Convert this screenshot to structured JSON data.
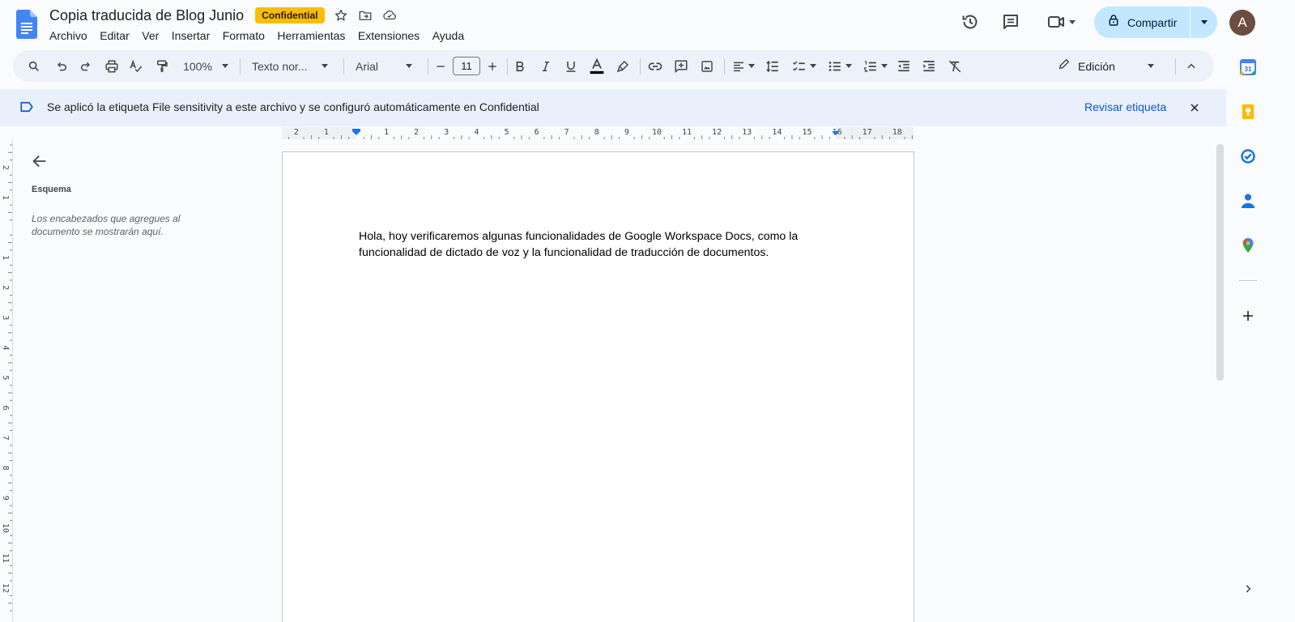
{
  "header": {
    "title": "Copia traducida de Blog Junio",
    "badge": "Confidential",
    "menu": [
      "Archivo",
      "Editar",
      "Ver",
      "Insertar",
      "Formato",
      "Herramientas",
      "Extensiones",
      "Ayuda"
    ],
    "share_label": "Compartir",
    "avatar_initial": "A"
  },
  "toolbar": {
    "zoom": "100%",
    "style": "Texto nor...",
    "font": "Arial",
    "font_size": "11",
    "mode": "Edición"
  },
  "notice": {
    "text": "Se aplicó la etiqueta File sensitivity a este archivo y se configuró automáticamente en Confidential",
    "link": "Revisar etiqueta"
  },
  "outline": {
    "title": "Esquema",
    "hint": "Los encabezados que agregues al documento se mostrarán aquí."
  },
  "document": {
    "body": "Hola, hoy verificaremos algunas funcionalidades de Google Workspace Docs, como la funcionalidad de dictado de voz y la funcionalidad de traducción de documentos."
  },
  "rulers": {
    "horizontal_labels": [
      "2",
      "1",
      "",
      "1",
      "2",
      "3",
      "4",
      "5",
      "6",
      "7",
      "8",
      "9",
      "10",
      "11",
      "12",
      "13",
      "14",
      "15",
      "16",
      "17",
      "18"
    ],
    "vertical_labels": [
      "2",
      "1",
      "",
      "1",
      "2",
      "3",
      "4",
      "5",
      "6",
      "7",
      "8",
      "9",
      "10",
      "11",
      "12"
    ]
  },
  "side_panel": {
    "calendar_day": "31"
  },
  "colors": {
    "accent": "#0b57d0",
    "share_bg": "#c2e7ff",
    "badge_bg": "#fbbc04",
    "toolbar_bg": "#edf2fa",
    "notice_bg": "#e9f0fc"
  },
  "icons": [
    "docs-logo-icon",
    "star-icon",
    "move-folder-icon",
    "cloud-saved-icon",
    "history-icon",
    "comment-icon",
    "meet-icon",
    "lock-icon",
    "search-icon",
    "undo-icon",
    "redo-icon",
    "print-icon",
    "spellcheck-icon",
    "paint-format-icon",
    "bold-icon",
    "italic-icon",
    "underline-icon",
    "text-color-icon",
    "highlight-icon",
    "link-icon",
    "add-comment-icon",
    "insert-image-icon",
    "align-icon",
    "line-spacing-icon",
    "checklist-icon",
    "bullet-list-icon",
    "numbered-list-icon",
    "indent-decrease-icon",
    "indent-increase-icon",
    "clear-format-icon",
    "pencil-icon",
    "chevron-up-icon",
    "label-icon",
    "close-icon",
    "back-arrow-icon",
    "calendar-icon",
    "keep-icon",
    "tasks-icon",
    "contacts-icon",
    "maps-icon",
    "plus-icon",
    "chevron-right-icon"
  ]
}
